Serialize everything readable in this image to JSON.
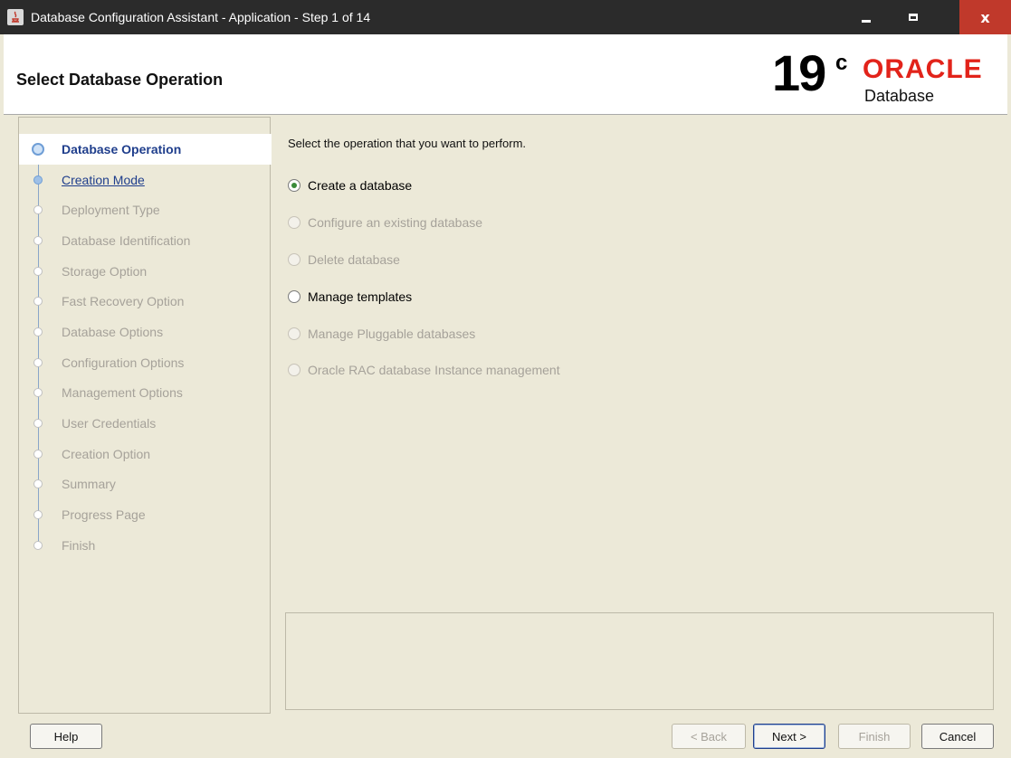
{
  "window": {
    "title": "Database Configuration Assistant - Application - Step 1 of 14",
    "controls": {
      "minimize": "minimize",
      "maximize": "maximize",
      "close": "x"
    }
  },
  "header": {
    "page_title": "Select Database Operation",
    "logo": {
      "version": "19",
      "superscript": "c",
      "brand": "ORACLE",
      "product": "Database"
    }
  },
  "sidebar": {
    "steps": [
      {
        "label": "Database Operation",
        "state": "current"
      },
      {
        "label": "Creation Mode",
        "state": "link"
      },
      {
        "label": "Deployment Type",
        "state": "disabled"
      },
      {
        "label": "Database Identification",
        "state": "disabled"
      },
      {
        "label": "Storage Option",
        "state": "disabled"
      },
      {
        "label": "Fast Recovery Option",
        "state": "disabled"
      },
      {
        "label": "Database Options",
        "state": "disabled"
      },
      {
        "label": "Configuration Options",
        "state": "disabled"
      },
      {
        "label": "Management Options",
        "state": "disabled"
      },
      {
        "label": "User Credentials",
        "state": "disabled"
      },
      {
        "label": "Creation Option",
        "state": "disabled"
      },
      {
        "label": "Summary",
        "state": "disabled"
      },
      {
        "label": "Progress Page",
        "state": "disabled"
      },
      {
        "label": "Finish",
        "state": "disabled"
      }
    ]
  },
  "main": {
    "prompt": "Select the operation that you want to perform.",
    "options": [
      {
        "label": "Create a database",
        "checked": true,
        "enabled": true
      },
      {
        "label": "Configure an existing database",
        "checked": false,
        "enabled": false
      },
      {
        "label": "Delete database",
        "checked": false,
        "enabled": false
      },
      {
        "label": "Manage templates",
        "checked": false,
        "enabled": true
      },
      {
        "label": "Manage Pluggable databases",
        "checked": false,
        "enabled": false
      },
      {
        "label": "Oracle RAC database Instance management",
        "checked": false,
        "enabled": false
      }
    ]
  },
  "footer": {
    "help": "Help",
    "back": "< Back",
    "next": "Next >",
    "finish": "Finish",
    "cancel": "Cancel"
  },
  "colors": {
    "title_bar": "#2b2b2b",
    "close_button": "#c0392b",
    "oracle_red": "#e2231a",
    "link_blue": "#1f3e8c",
    "panel_bg": "#ece9d8"
  }
}
